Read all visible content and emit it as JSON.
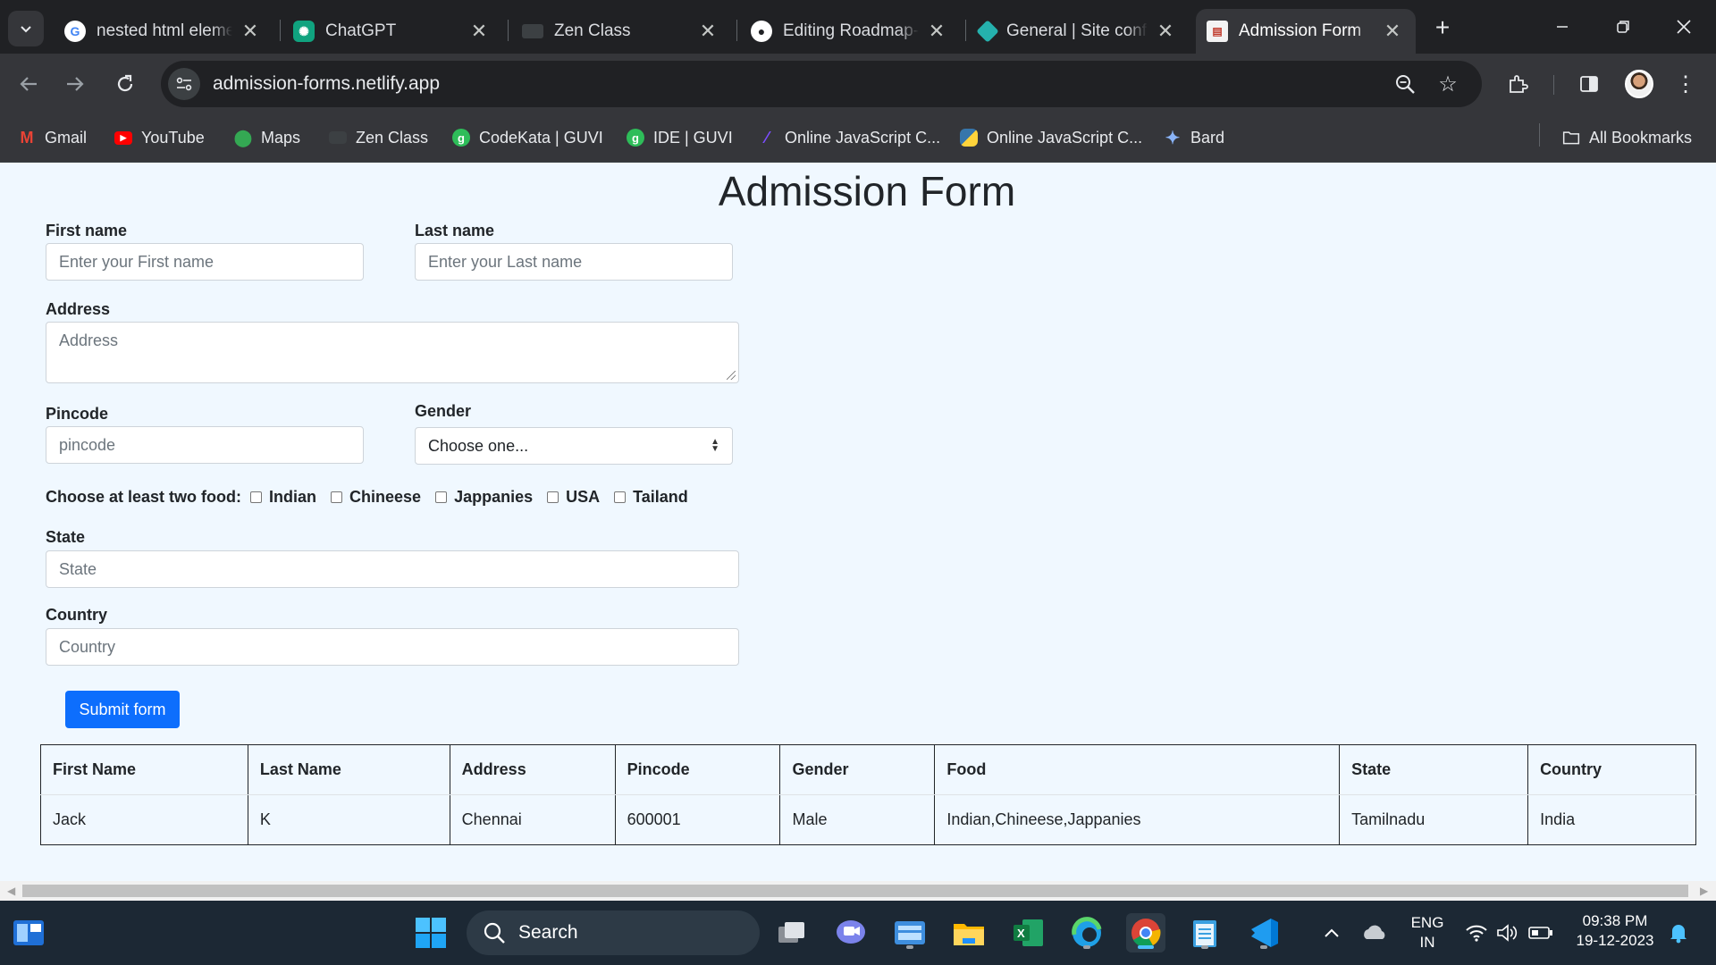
{
  "browser": {
    "tabs": [
      {
        "title": "nested html eleme",
        "icon": "google-icon"
      },
      {
        "title": "ChatGPT",
        "icon": "chatgpt-icon"
      },
      {
        "title": "Zen Class",
        "icon": "zen-class-icon"
      },
      {
        "title": "Editing Roadmap-l",
        "icon": "github-icon"
      },
      {
        "title": "General | Site confi",
        "icon": "netlify-icon"
      },
      {
        "title": "Admission Form",
        "icon": "form-icon",
        "active": true
      }
    ],
    "url": "admission-forms.netlify.app",
    "bookmarks": [
      {
        "label": "Gmail",
        "icon": "gmail-icon"
      },
      {
        "label": "YouTube",
        "icon": "youtube-icon"
      },
      {
        "label": "Maps",
        "icon": "maps-icon"
      },
      {
        "label": "Zen Class",
        "icon": "zen-class-icon"
      },
      {
        "label": "CodeKata | GUVI",
        "icon": "guvi-icon"
      },
      {
        "label": "IDE | GUVI",
        "icon": "guvi-icon"
      },
      {
        "label": "Online JavaScript C...",
        "icon": "js-compiler-icon"
      },
      {
        "label": "Online JavaScript C...",
        "icon": "python-icon"
      },
      {
        "label": "Bard",
        "icon": "bard-icon"
      }
    ],
    "all_bookmarks": "All Bookmarks"
  },
  "form": {
    "title": "Admission Form",
    "first_name_label": "First name",
    "first_name_placeholder": "Enter your First name",
    "last_name_label": "Last name",
    "last_name_placeholder": "Enter your Last name",
    "address_label": "Address",
    "address_placeholder": "Address",
    "pincode_label": "Pincode",
    "pincode_placeholder": "pincode",
    "gender_label": "Gender",
    "gender_selected": "Choose one...",
    "food_label": "Choose at least two food:",
    "food_options": [
      "Indian",
      "Chineese",
      "Jappanies",
      "USA",
      "Tailand"
    ],
    "state_label": "State",
    "state_placeholder": "State",
    "country_label": "Country",
    "country_placeholder": "Country",
    "submit_label": "Submit form"
  },
  "table": {
    "headers": [
      "First Name",
      "Last Name",
      "Address",
      "Pincode",
      "Gender",
      "Food",
      "State",
      "Country"
    ],
    "rows": [
      [
        "Jack",
        "K",
        "Chennai",
        "600001",
        "Male",
        "Indian,Chineese,Jappanies",
        "Tamilnadu",
        "India"
      ]
    ]
  },
  "taskbar": {
    "search_label": "Search",
    "lang_line1": "ENG",
    "lang_line2": "IN",
    "time": "09:38 PM",
    "date": "19-12-2023"
  }
}
